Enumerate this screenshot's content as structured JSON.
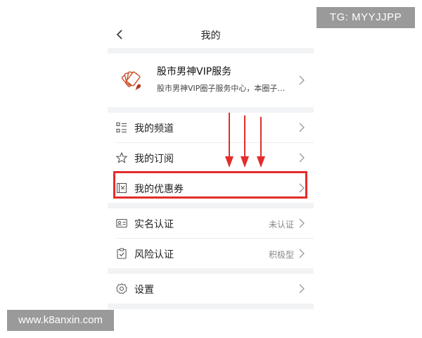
{
  "watermarks": {
    "tg": "TG: MYYJJPP",
    "site": "www.k8anxin.com"
  },
  "nav": {
    "title": "我的",
    "back_icon": "chevron-left-icon"
  },
  "profile": {
    "name": "股市男神VIP服务",
    "description": "股市男神VIP圈子服务中心，本圈子…",
    "avatar_icon": "playing-cards-icon"
  },
  "menu": {
    "group1": [
      {
        "label": "我的频道",
        "icon": "grid-list-icon"
      },
      {
        "label": "我的订阅",
        "icon": "star-icon"
      },
      {
        "label": "我的优惠券",
        "icon": "coupon-icon",
        "highlighted": true
      }
    ],
    "group2": [
      {
        "label": "实名认证",
        "value": "未认证",
        "icon": "id-card-icon"
      },
      {
        "label": "风险认证",
        "value": "积极型",
        "icon": "clipboard-check-icon"
      }
    ],
    "group3": [
      {
        "label": "设置",
        "icon": "gear-icon"
      }
    ]
  },
  "colors": {
    "highlight": "#e32c2c",
    "section_gap": "#f2f3f5",
    "watermark_bg": "#9a9a9a"
  }
}
